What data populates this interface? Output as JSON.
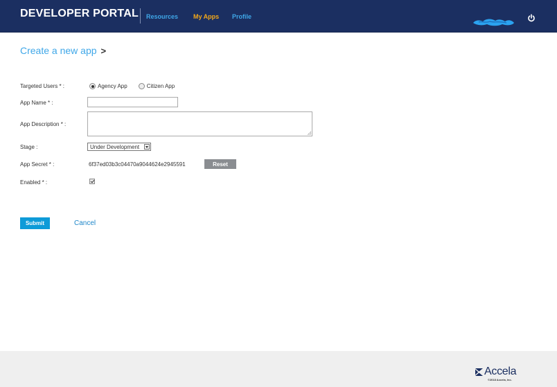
{
  "header": {
    "brand": "DEVELOPER PORTAL",
    "nav": [
      {
        "label": "Resources"
      },
      {
        "label": "My Apps"
      },
      {
        "label": "Profile"
      }
    ],
    "colors": {
      "background": "#1b2f61",
      "nav_link": "#3fa7e8",
      "nav_active": "#f3a81a"
    }
  },
  "page": {
    "title": "Create a new app",
    "title_chevron": ">"
  },
  "form": {
    "targeted_users": {
      "label": "Targeted Users * :",
      "options": [
        "Agency App",
        "Citizen App"
      ],
      "selected": "Agency App"
    },
    "app_name": {
      "label": "App Name * :",
      "value": ""
    },
    "app_description": {
      "label": "App Description * :",
      "value": ""
    },
    "stage": {
      "label": "Stage :",
      "value": "Under Development"
    },
    "app_secret": {
      "label": "App Secret * :",
      "value": "6f37ed03b3c04470a9044624e2945591",
      "reset_label": "Reset"
    },
    "enabled": {
      "label": "Enabled * :",
      "checked": true
    }
  },
  "actions": {
    "submit_label": "Submit",
    "cancel_label": "Cancel"
  },
  "footer": {
    "logo_text": "Accela",
    "copyright": "©2018 Accela, Inc."
  }
}
